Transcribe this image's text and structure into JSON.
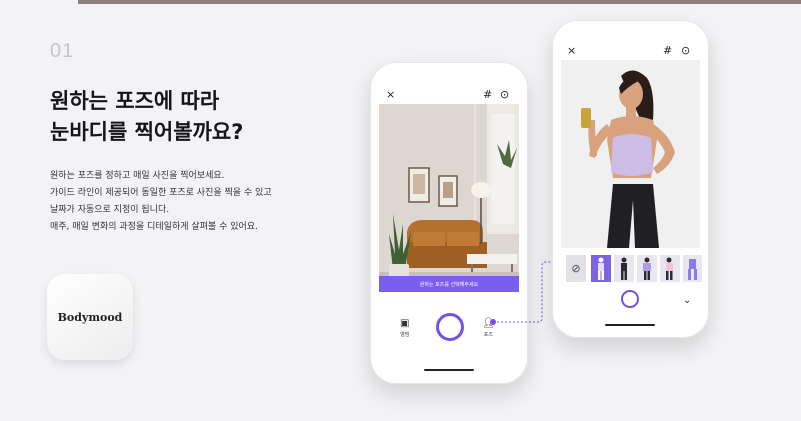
{
  "step": {
    "number": "01"
  },
  "headline": {
    "line1": "원하는 포즈에 따라",
    "line2": "눈바디를 찍어볼까요?"
  },
  "description": {
    "line1": "원하는 포즈를 정하고 매일 사진을 찍어보세요.",
    "line2": "가이드 라인이 제공되어 동일한 포즈로 사진을 찍을 수 있고",
    "line3": "날짜가 자동으로 지정이 됩니다.",
    "line4": "매주, 매일 변화의 과정을 디테일하게 살펴볼 수 있어요."
  },
  "app_logo": {
    "label": "Bodymood"
  },
  "left_phone": {
    "close_icon": "×",
    "grid_icon": "#",
    "settings_icon": "⊙",
    "guide_banner": "원하는 포즈를 선택해주세요",
    "nav_gallery_label": "앨범",
    "nav_pose_label": "포즈"
  },
  "right_phone": {
    "close_icon": "×",
    "grid_icon": "#",
    "settings_icon": "⊙",
    "no_pose_icon": "⊘",
    "chevron_icon": "⌄"
  },
  "colors": {
    "accent": "#7451e8",
    "banner": "#7a5ef0",
    "top_bar": "#8b7e78"
  }
}
